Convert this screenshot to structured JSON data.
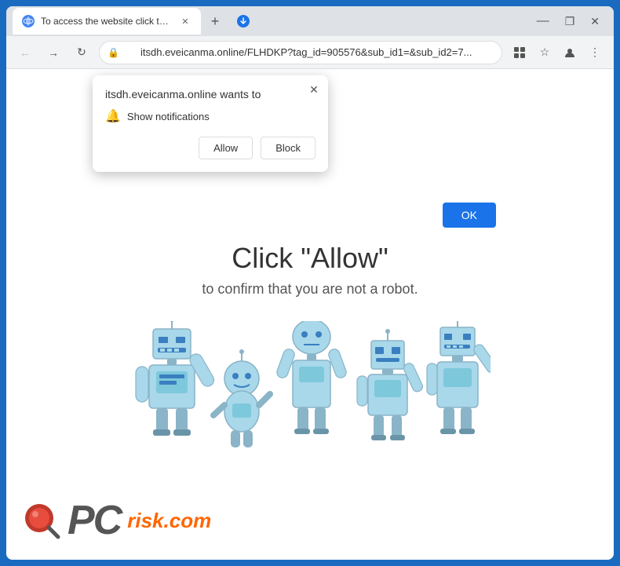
{
  "browser": {
    "tab": {
      "title": "To access the website click the \"A",
      "favicon": "globe"
    },
    "address": {
      "url": "itsdh.eveicanma.online/FLHDKP?tag_id=905576&sub_id1=&sub_id2=7...",
      "domain": "itsdh.eveicanma.online"
    },
    "controls": {
      "minimize": "—",
      "maximize": "❐",
      "close": "✕"
    }
  },
  "popup": {
    "title": "itsdh.eveicanma.online wants to",
    "notification_label": "Show notifications",
    "allow_button": "Allow",
    "block_button": "Block",
    "close_icon": "✕"
  },
  "ok_button": "OK",
  "main": {
    "heading": "Click \"Allow\"",
    "subheading": "to confirm that you are not a robot."
  },
  "footer": {
    "brand_pc": "PC",
    "brand_risk": "risk.com"
  }
}
